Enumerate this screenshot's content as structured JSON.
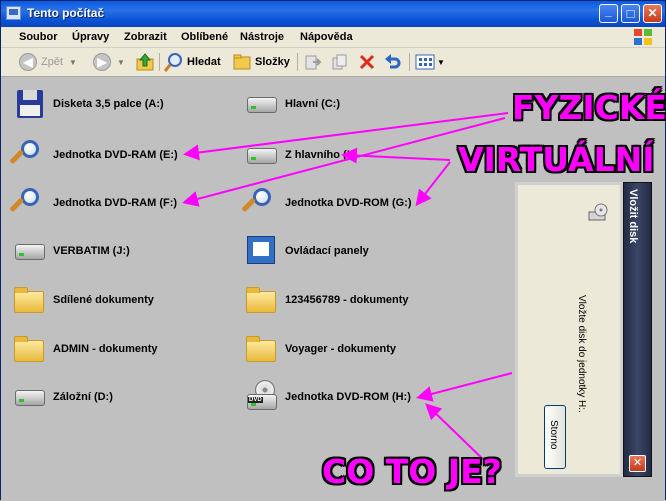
{
  "window": {
    "title": "Tento počítač"
  },
  "menu": [
    "Soubor",
    "Úpravy",
    "Zobrazit",
    "Oblíbené",
    "Nástroje",
    "Nápověda"
  ],
  "toolbar": {
    "back": "Zpět",
    "search": "Hledat",
    "folders": "Složky"
  },
  "drives": {
    "floppy": "Disketa 3,5 palce (A:)",
    "hlavni": "Hlavní (C:)",
    "dvdram_e": "Jednotka DVD-RAM (E:)",
    "z_hlavniho": "Z hlavního (I:)",
    "dvdram_f": "Jednotka DVD-RAM (F:)",
    "dvdrom_g": "Jednotka DVD-ROM (G:)",
    "verbatim": "VERBATIM (J:)",
    "ovladaci": "Ovládací panely",
    "sdilene": "Sdílené dokumenty",
    "doc123": "123456789 - dokumenty",
    "admin": "ADMIN - dokumenty",
    "voyager": "Voyager - dokumenty",
    "zalozni": "Záložní (D:)",
    "dvdrom_h": "Jednotka DVD-ROM (H:)"
  },
  "icons": {
    "dvd_badge": "DVD"
  },
  "annotations": {
    "physical": "FYZICKÉ",
    "virtual": "VIRTUÁLNÍ",
    "question": "CO TO JE?"
  },
  "dialog": {
    "title": "Vložit disk",
    "message": "Vložte disk do jednotky H:.",
    "button": "Storno"
  },
  "colors": {
    "annotation": "#ff00ff",
    "titlebar": "#0a5be0"
  }
}
